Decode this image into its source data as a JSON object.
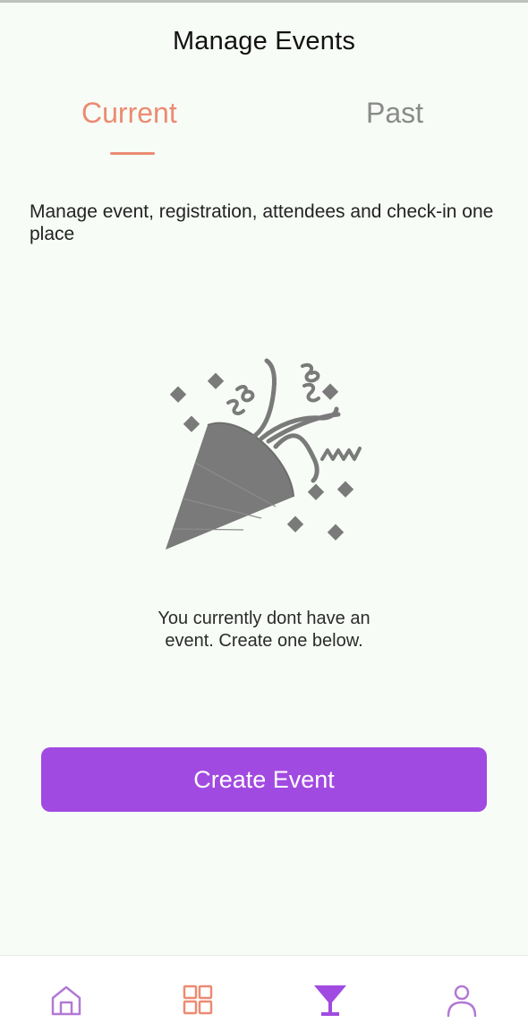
{
  "header": {
    "title": "Manage Events"
  },
  "tabs": [
    {
      "label": "Current",
      "active": true
    },
    {
      "label": "Past",
      "active": false
    }
  ],
  "description": "Manage event, registration, attendees and check-in one place",
  "illustration": {
    "icon": "party-popper-icon",
    "color": "#7a7a7a"
  },
  "empty_state": {
    "line1": "You currently dont have an",
    "line2": "event. Create one below."
  },
  "create_button": {
    "label": "Create Event",
    "color": "#a14ae1"
  },
  "bottom_nav": {
    "items": [
      {
        "icon": "home-icon",
        "color": "#b279d4"
      },
      {
        "icon": "grid-icon",
        "color": "#ec8b72"
      },
      {
        "icon": "cocktail-glass-icon",
        "color": "#a14ae1",
        "active": true
      },
      {
        "icon": "user-icon",
        "color": "#b279d4"
      }
    ]
  },
  "theme": {
    "background": "#f7fcf6",
    "accent": "#ec8b72",
    "primary": "#a14ae1"
  }
}
